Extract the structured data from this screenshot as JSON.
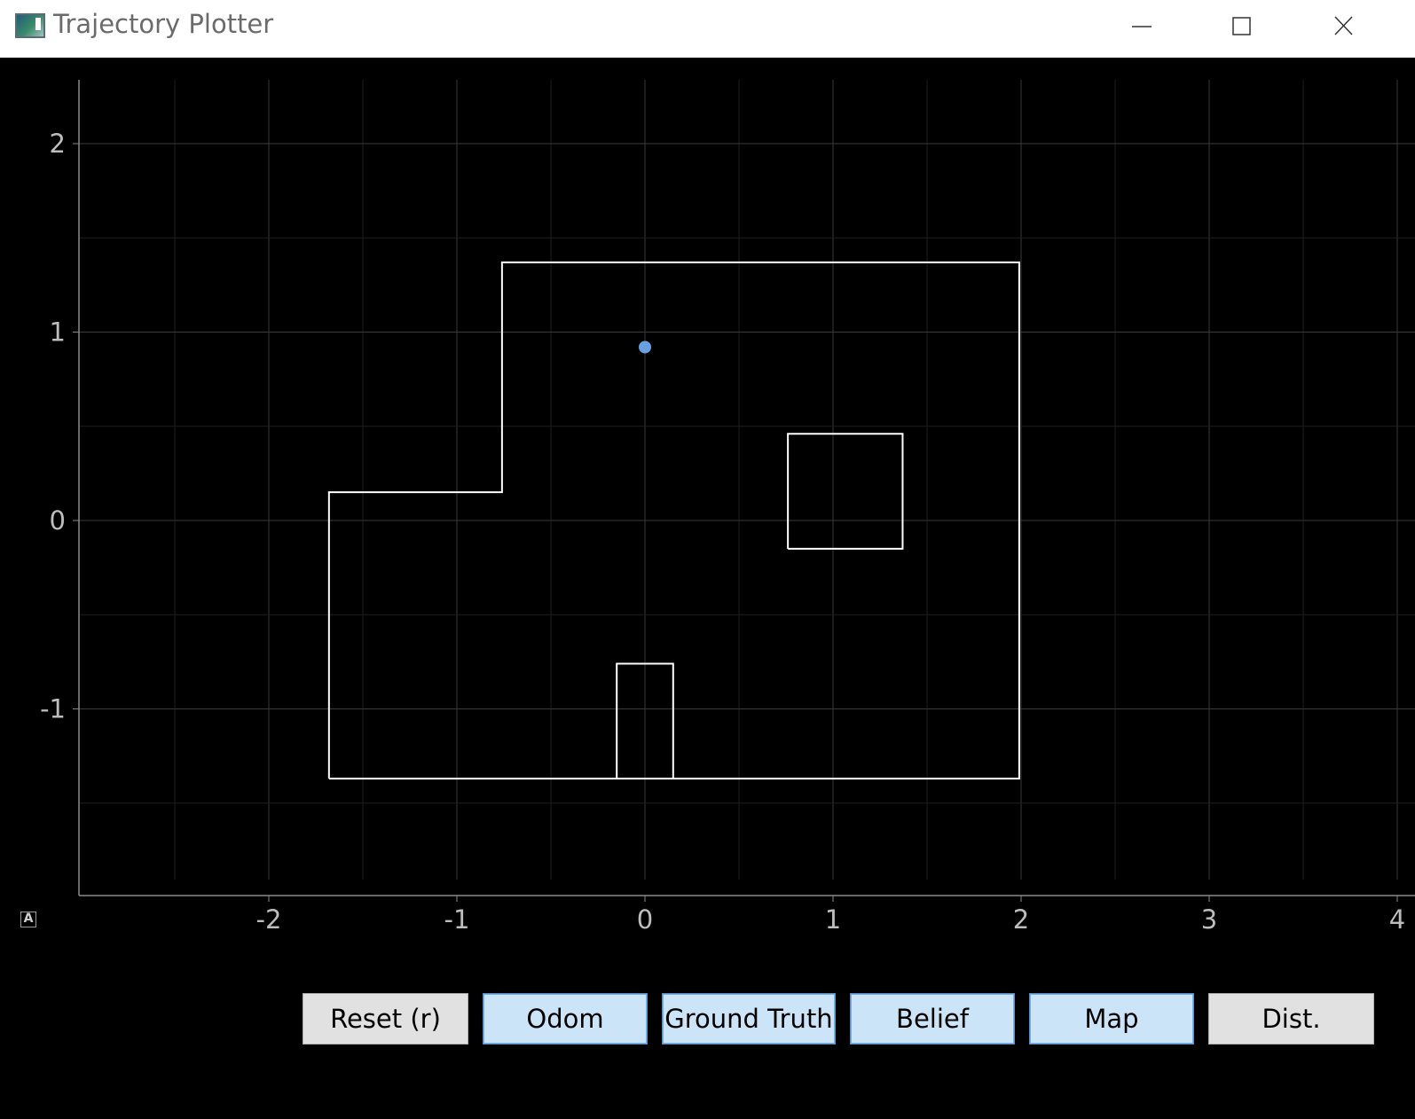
{
  "window": {
    "title": "Trajectory Plotter",
    "controls": [
      "minimize-icon",
      "maximize-icon",
      "close-icon"
    ]
  },
  "plot": {
    "background": "#000000",
    "grid": true,
    "x_ticks": [
      "-2",
      "-1",
      "0",
      "1",
      "2",
      "3",
      "4"
    ],
    "y_ticks": [
      "2",
      "1",
      "0",
      "-1"
    ],
    "autoscale_label": "A"
  },
  "chart_data": {
    "type": "line",
    "xlim": [
      -3.0,
      4.0
    ],
    "ylim": [
      -2.0,
      2.3
    ],
    "x_ticks": [
      -2,
      -1,
      0,
      1,
      2,
      3,
      4
    ],
    "y_ticks": [
      -1,
      0,
      1,
      2
    ],
    "map": {
      "color": "#ffffff",
      "polygons": [
        [
          [
            -1.68,
            -1.37
          ],
          [
            -1.68,
            0.15
          ],
          [
            -0.76,
            0.15
          ],
          [
            -0.76,
            1.37
          ],
          [
            1.99,
            1.37
          ],
          [
            1.99,
            -1.37
          ],
          [
            -1.68,
            -1.37
          ]
        ],
        [
          [
            0.76,
            -0.15
          ],
          [
            0.76,
            0.46
          ],
          [
            1.37,
            0.46
          ],
          [
            1.37,
            -0.15
          ],
          [
            0.76,
            -0.15
          ]
        ],
        [
          [
            -0.15,
            -1.37
          ],
          [
            -0.15,
            -0.76
          ],
          [
            0.15,
            -0.76
          ],
          [
            0.15,
            -1.37
          ]
        ]
      ]
    },
    "robot_position": {
      "x": 0.0,
      "y": 0.92,
      "color": "#6a9fe0"
    }
  },
  "buttons": [
    {
      "label": "Reset (r)",
      "active": false
    },
    {
      "label": "Odom",
      "active": true
    },
    {
      "label": "Ground Truth",
      "active": true
    },
    {
      "label": "Belief",
      "active": true
    },
    {
      "label": "Map",
      "active": true
    },
    {
      "label": "Dist.",
      "active": false
    }
  ]
}
